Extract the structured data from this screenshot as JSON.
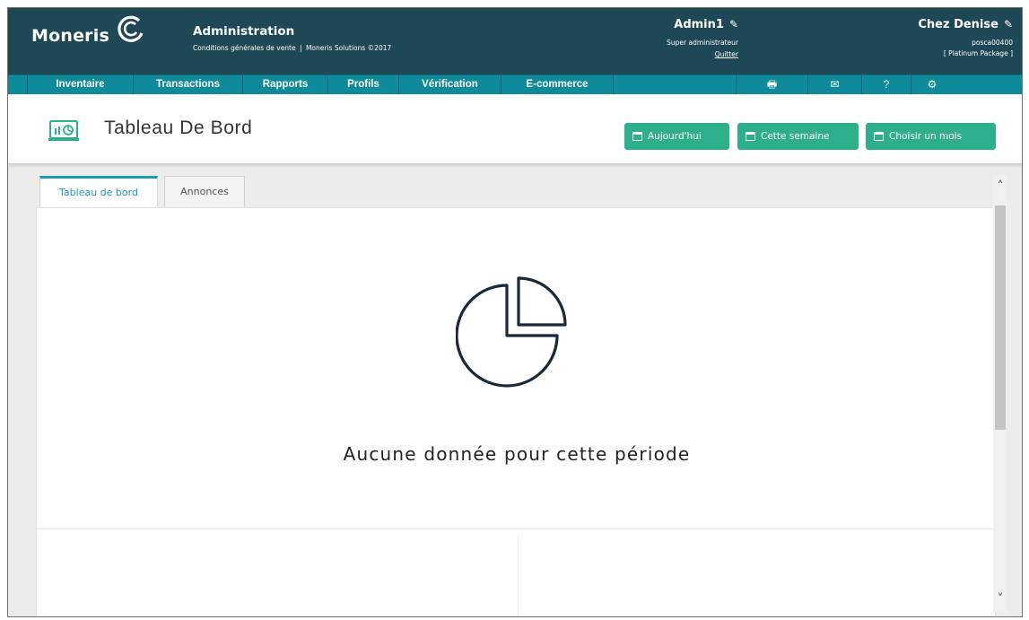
{
  "header": {
    "brand": "Moneris",
    "section_title": "Administration",
    "terms_link": "Conditions générales de vente",
    "copyright": "Moneris Solutions ©2017",
    "user": {
      "name": "Admin1",
      "role": "Super administrateur",
      "logout": "Quitter"
    },
    "store": {
      "name": "Chez Denise",
      "id": "posca00400",
      "package": "[ Platinum Package ]"
    }
  },
  "nav": {
    "items": [
      "Inventaire",
      "Transactions",
      "Rapports",
      "Profils",
      "Vérification",
      "E-commerce"
    ],
    "icons": [
      "printer-icon",
      "mail-icon",
      "help-icon",
      "settings-icon"
    ]
  },
  "page": {
    "title": "Tableau De Bord",
    "buttons": {
      "today": "Aujourd'hui",
      "this_week": "Cette semaine",
      "choose_month": "Choisir un mois"
    }
  },
  "tabs": {
    "dashboard": "Tableau de bord",
    "announcements": "Annonces"
  },
  "content": {
    "empty_message": "Aucune donnée pour cette période"
  },
  "colors": {
    "header_bg": "#1e4856",
    "nav_bg": "#0e8a9a",
    "button_bg": "#2eaf8c",
    "tab_active": "#1f9ab3"
  }
}
